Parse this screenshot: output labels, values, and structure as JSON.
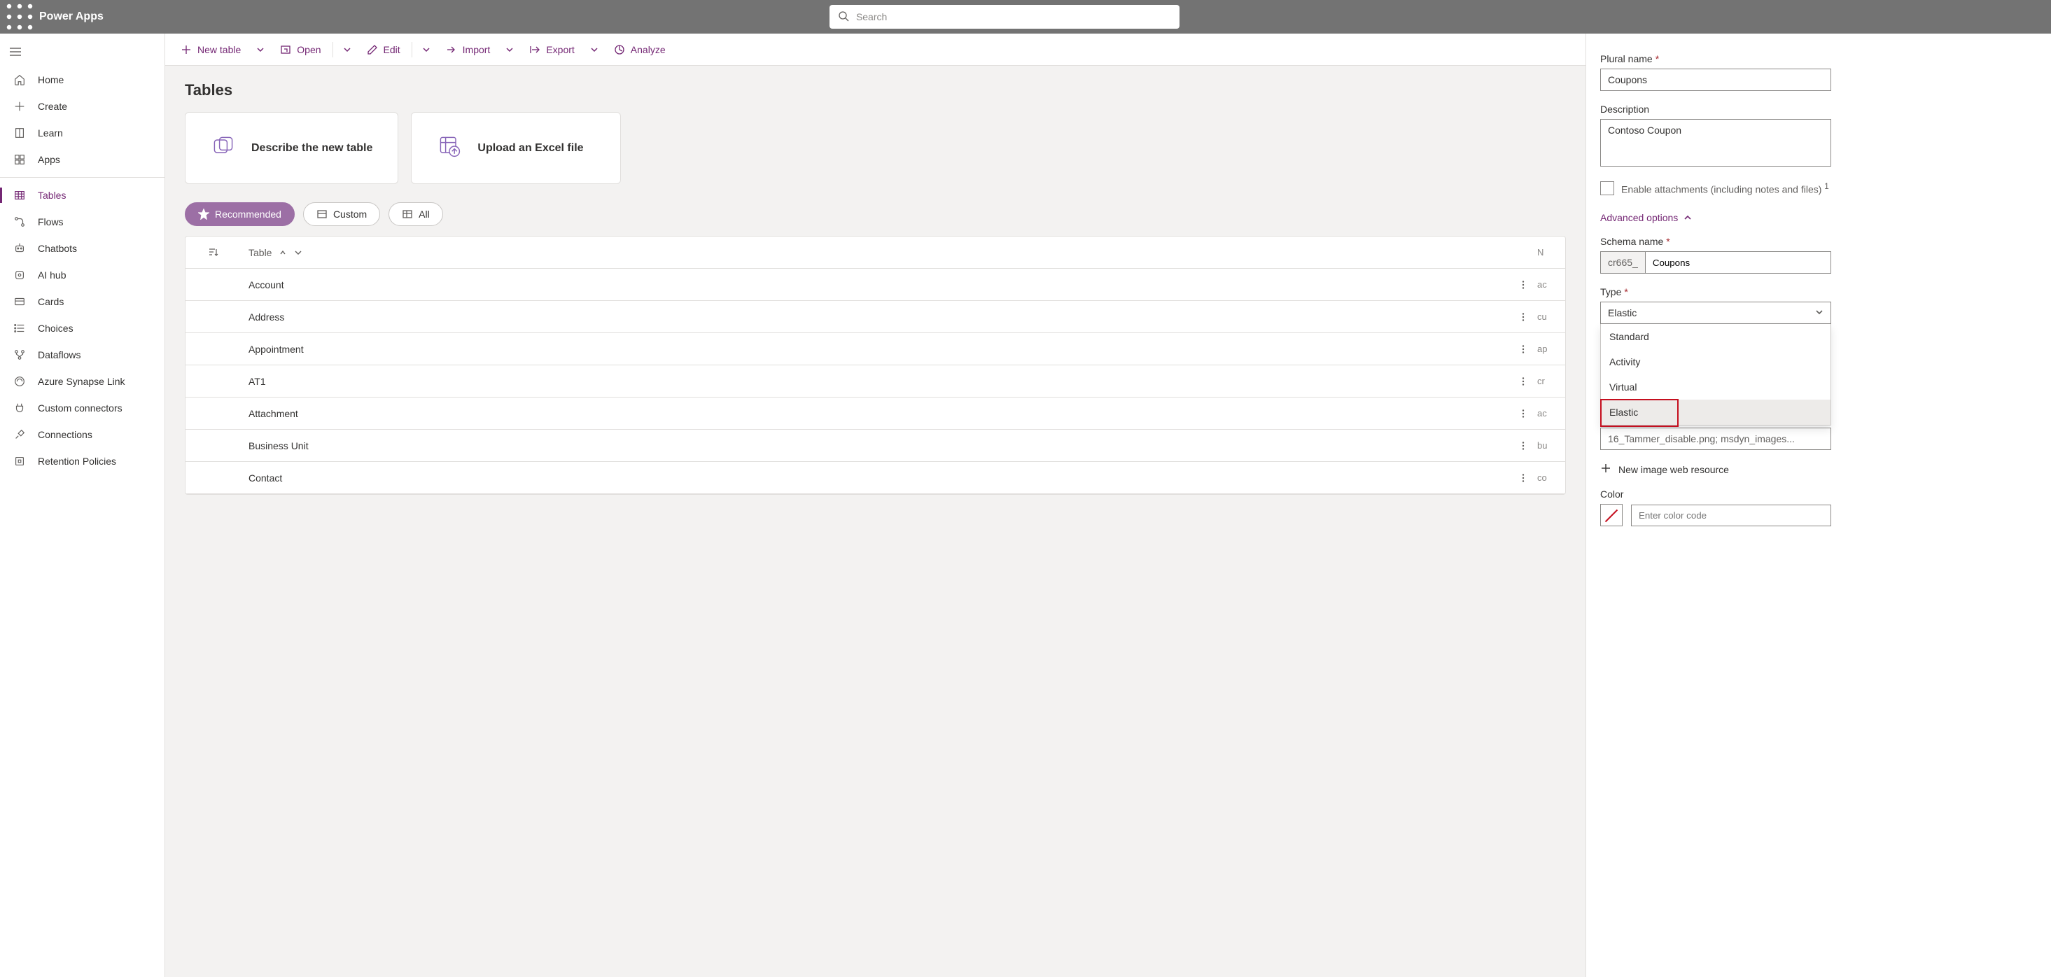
{
  "header": {
    "app_title": "Power Apps",
    "search_placeholder": "Search"
  },
  "nav": {
    "items": [
      {
        "id": "home",
        "label": "Home"
      },
      {
        "id": "create",
        "label": "Create"
      },
      {
        "id": "learn",
        "label": "Learn"
      },
      {
        "id": "apps",
        "label": "Apps"
      },
      {
        "id": "tables",
        "label": "Tables",
        "selected": true
      },
      {
        "id": "flows",
        "label": "Flows"
      },
      {
        "id": "chatbots",
        "label": "Chatbots"
      },
      {
        "id": "aihub",
        "label": "AI hub"
      },
      {
        "id": "cards",
        "label": "Cards"
      },
      {
        "id": "choices",
        "label": "Choices"
      },
      {
        "id": "dataflows",
        "label": "Dataflows"
      },
      {
        "id": "synapse",
        "label": "Azure Synapse Link"
      },
      {
        "id": "connectors",
        "label": "Custom connectors"
      },
      {
        "id": "connections",
        "label": "Connections"
      },
      {
        "id": "retention",
        "label": "Retention Policies"
      }
    ]
  },
  "cmd": {
    "new_table": "New table",
    "open": "Open",
    "edit": "Edit",
    "import": "Import",
    "export": "Export",
    "analyze": "Analyze"
  },
  "page": {
    "title": "Tables",
    "card_describe": "Describe the new table",
    "card_upload": "Upload an Excel file"
  },
  "pills": {
    "recommended": "Recommended",
    "custom": "Custom",
    "all": "All"
  },
  "table": {
    "header": "Table",
    "header_right": "N",
    "rows": [
      {
        "name": "Account",
        "right": "ac"
      },
      {
        "name": "Address",
        "right": "cu"
      },
      {
        "name": "Appointment",
        "right": "ap"
      },
      {
        "name": "AT1",
        "right": "cr"
      },
      {
        "name": "Attachment",
        "right": "ac"
      },
      {
        "name": "Business Unit",
        "right": "bu"
      },
      {
        "name": "Contact",
        "right": "co"
      }
    ]
  },
  "panel": {
    "plural_name_label": "Plural name",
    "plural_name_value": "Coupons",
    "description_label": "Description",
    "description_value": "Contoso Coupon",
    "attachments_label": "Enable attachments (including notes and files)",
    "attachments_sup": "1",
    "advanced_label": "Advanced options",
    "schema_label": "Schema name",
    "schema_prefix": "cr665_",
    "schema_value": "Coupons",
    "type_label": "Type",
    "type_value": "Elastic",
    "type_options": [
      "Standard",
      "Activity",
      "Virtual",
      "Elastic"
    ],
    "hidden_resource_text": "16_Tammer_disable.png; msdyn_images...",
    "new_image_label": "New image web resource",
    "color_label": "Color",
    "color_placeholder": "Enter color code"
  }
}
